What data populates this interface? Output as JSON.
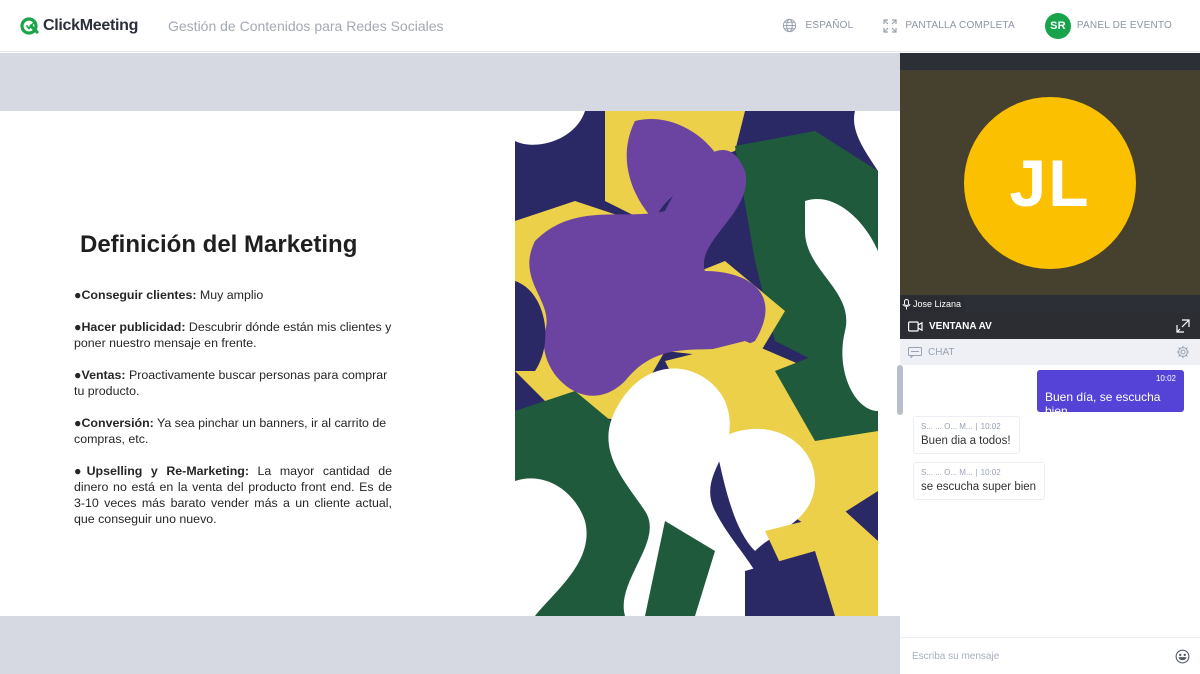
{
  "header": {
    "logo_text": "ClickMeeting",
    "event_title": "Gestión de Contenidos para Redes Sociales",
    "language_label": "ESPAÑOL",
    "fullscreen_label": "PANTALLA COMPLETA",
    "user_initials": "SR",
    "event_panel_label": "PANEL DE EVENTO",
    "colors": {
      "brand_green": "#1ca34a",
      "avatar_green": "#16a34a"
    }
  },
  "slide": {
    "title": "Definición del Marketing",
    "bullets": [
      {
        "marker": "●",
        "heading": "Conseguir clientes:",
        "text": " Muy amplio"
      },
      {
        "marker": "●",
        "heading": "Hacer publicidad:",
        "text": " Descubrir dónde están mis clientes y poner nuestro mensaje en frente."
      },
      {
        "marker": "●",
        "heading": "Ventas:",
        "text": " Proactivamente buscar personas para comprar tu producto."
      },
      {
        "marker": "●",
        "heading": "Conversión:",
        "text": " Ya sea pinchar un banners, ir al carrito de compras, etc."
      },
      {
        "marker": "●",
        "heading": "Upselling y Re-Marketing:",
        "text": " La mayor cantidad de dinero no está en la venta del producto front end. Es de 3-10 veces más barato vender más a un cliente actual, que conseguir uno nuevo."
      }
    ],
    "art_colors": {
      "navy": "#2b2866",
      "yellow": "#ecd04a",
      "purple": "#6a44a0",
      "green": "#1f5a3c",
      "white": "#ffffff"
    }
  },
  "video": {
    "initials": "JL",
    "participant_name": "Jose Lizana",
    "avatar_color": "#fbc000",
    "window_label": "VENTANA AV"
  },
  "chat": {
    "title": "CHAT",
    "messages": [
      {
        "mine": true,
        "time": "10:02",
        "text": "Buen día, se escucha bien"
      },
      {
        "mine": false,
        "sender": "S... ... O... M...",
        "time": "10:02",
        "text": "Buen dia a todos!"
      },
      {
        "mine": false,
        "sender": "S... ... O... M...",
        "time": "10:02",
        "text": "se escucha super bien"
      }
    ],
    "input_placeholder": "Escriba su mensaje",
    "my_bubble_color": "#5443d6"
  }
}
